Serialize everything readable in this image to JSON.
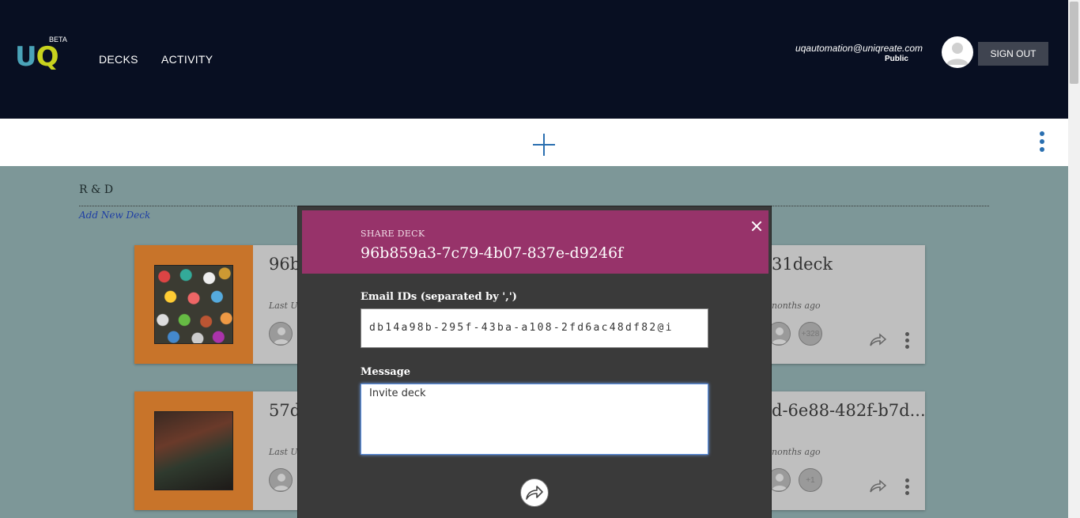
{
  "header": {
    "logo_u": "U",
    "logo_q": "Q",
    "beta": "BETA",
    "nav": [
      {
        "label": "DECKS"
      },
      {
        "label": "ACTIVITY"
      }
    ],
    "user_email": "uqautomation@uniqreate.com",
    "user_role": "Public",
    "signout_label": "SIGN OUT"
  },
  "section": {
    "title": "R & D",
    "add_deck_label": "Add New Deck"
  },
  "cards": [
    {
      "title_left": "96b",
      "title_right": "31deck",
      "meta_left": "Last Up",
      "meta_right": "nonths ago",
      "count": "+328"
    },
    {
      "title_left": "57d",
      "title_right": "d-6e88-482f-b7d...",
      "meta_left": "Last Up",
      "meta_right": "nonths ago",
      "count": "+1"
    }
  ],
  "modal": {
    "kicker": "SHARE DECK",
    "title": "96b859a3-7c79-4b07-837e-d9246f",
    "email_label": "Email IDs (separated by ',')",
    "email_value": "db14a98b-295f-43ba-a108-2fd6ac48df82@i",
    "message_label": "Message",
    "message_value": "Invite deck"
  },
  "colors": {
    "header_bg": "#080f22",
    "modal_header": "#97336a",
    "accent_blue": "#2a6fb0",
    "card_thumb": "#c8742a"
  }
}
